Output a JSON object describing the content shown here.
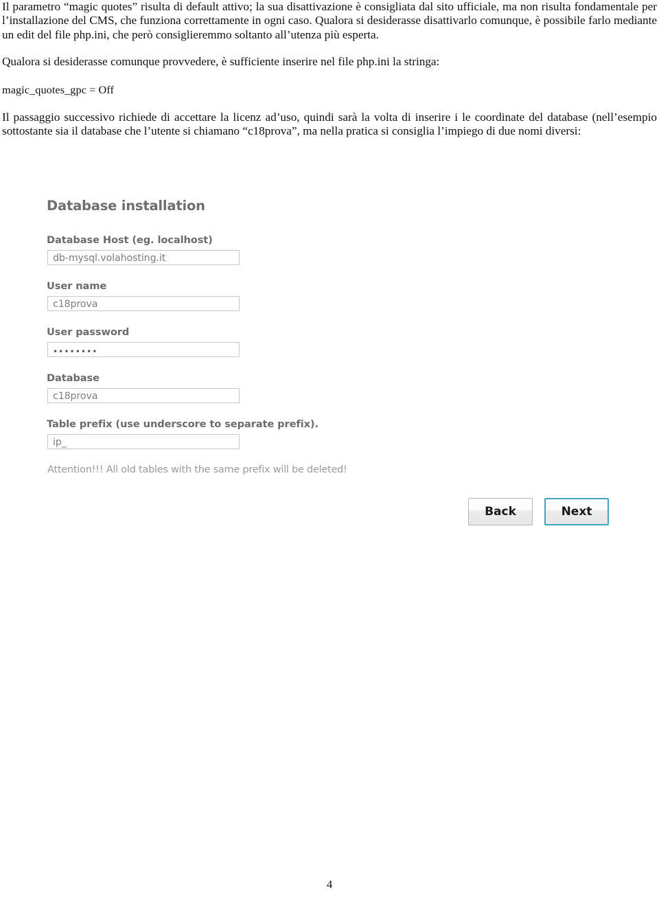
{
  "document": {
    "paragraphs": [
      {
        "id": "p1",
        "text": "Il parametro “magic quotes” risulta di default attivo; la sua disattivazione è consigliata dal sito ufficiale, ma non risulta fondamentale per l’installazione del CMS, che funziona correttamente in ogni caso. Qualora si desiderasse disattivarlo comunque, è possibile farlo mediante un edit del file php.ini, che però consiglieremmo soltanto all’utenza più esperta."
      },
      {
        "id": "p2",
        "text": "Qualora si desiderasse comunque provvedere, è sufficiente inserire nel file php.ini la stringa:"
      },
      {
        "id": "code",
        "text": "magic_quotes_gpc = Off"
      },
      {
        "id": "p3",
        "text": "Il passaggio successivo richiede di accettare la licenz ad’uso, quindi sarà la volta di inserire i le coordinate del database (nell’esempio sottostante sia il database che l’utente si chiamano “c18prova”, ma nella pratica si consiglia l’impiego di due nomi diversi:"
      }
    ],
    "page_number": "4"
  },
  "installer": {
    "title": "Database installation",
    "fields": [
      {
        "label": "Database Host (eg. localhost)",
        "value": "db-mysql.volahosting.it",
        "type": "text"
      },
      {
        "label": "User name",
        "value": "c18prova",
        "type": "text"
      },
      {
        "label": "User password",
        "value": "••••••••",
        "type": "password"
      },
      {
        "label": "Database",
        "value": "c18prova",
        "type": "text"
      },
      {
        "label": "Table prefix (use underscore to separate prefix).",
        "value": "ip_",
        "type": "text"
      }
    ],
    "attention": "Attention!!! All old tables with the same prefix will be deleted!",
    "buttons": {
      "back": "Back",
      "next": "Next"
    },
    "colors": {
      "label": "#6b6b6b",
      "title": "#6e6e6e",
      "value": "#7d7d7d",
      "attention": "#9a9a9a",
      "input_border": "#c8c8c8",
      "button_border": "#b6b6b6",
      "primary_button_border": "#3fa8c0"
    }
  }
}
